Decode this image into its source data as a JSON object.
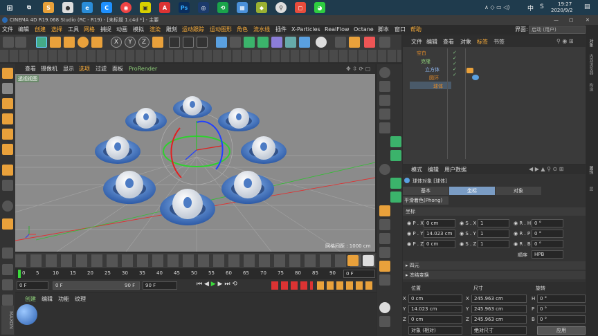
{
  "taskbar": {
    "time": "19:27",
    "date": "2020/9/2",
    "lang": "中",
    "input_s": "S"
  },
  "window": {
    "title": "CINEMA 4D R19.068 Studio (RC - R19) - [未标题 1.c4d *] - 主要"
  },
  "menu": [
    "文件",
    "编辑",
    "创建",
    "选择",
    "工具",
    "网格",
    "捕捉",
    "动画",
    "模拟",
    "渲染",
    "雕刻",
    "运动跟踪",
    "运动图形",
    "角色",
    "流水线",
    "插件",
    "X-Particles",
    "RealFlow",
    "Octane",
    "脚本",
    "窗口",
    "帮助"
  ],
  "interface": {
    "label": "界面:",
    "value": "启动 (用户)"
  },
  "viewport": {
    "menu": [
      "查看",
      "摄像机",
      "显示",
      "选项",
      "过滤",
      "面板",
      "ProRender"
    ],
    "view_label": "透视视图",
    "grid_spacing": "网格间距 : 1000 cm"
  },
  "objects": {
    "menu": [
      "文件",
      "编辑",
      "查看",
      "对象",
      "标签",
      "书签"
    ],
    "tree": [
      "空白",
      "克隆",
      "立方体",
      "圆环",
      "球体"
    ]
  },
  "attributes": {
    "menu": [
      "模式",
      "编辑",
      "用户数据"
    ],
    "object_title": "球体对象 [球体]",
    "tabs": [
      "基本",
      "坐标",
      "对象"
    ],
    "phong": "平滑着色(Phong)",
    "section": "坐标",
    "px": "0 cm",
    "py": "14.023 cm",
    "pz": "0 cm",
    "sx": "1",
    "sy": "1",
    "sz": "1",
    "rh": "0 °",
    "rp": "0 °",
    "rb": "0 °",
    "order_label": "顺序",
    "order": "HPB",
    "quat": "四元",
    "freeze": "冻结变换"
  },
  "coords": {
    "h_pos": "位置",
    "h_size": "尺寸",
    "h_rot": "旋转",
    "x": "0 cm",
    "y": "14.023 cm",
    "z": "0 cm",
    "sx": "245.963 cm",
    "sy": "245.963 cm",
    "sz": "245.963 cm",
    "h": "0 °",
    "p": "0 °",
    "b": "0 °",
    "mode": "对象 (相对)",
    "size_mode": "绝对尺寸",
    "apply": "应用"
  },
  "timeline": {
    "ticks": [
      "0",
      "5",
      "10",
      "15",
      "20",
      "25",
      "30",
      "35",
      "40",
      "45",
      "50",
      "55",
      "60",
      "65",
      "70",
      "75",
      "80",
      "85",
      "90"
    ],
    "frame_end": "0 F",
    "start": "0 F",
    "cur": "0 F",
    "end": "90 F",
    "end2": "90 F"
  },
  "materials": {
    "menu": [
      "创建",
      "编辑",
      "功能",
      "纹理"
    ]
  },
  "side_tabs": [
    "对象",
    "内容浏览器",
    "构造",
    "属性",
    "层"
  ]
}
